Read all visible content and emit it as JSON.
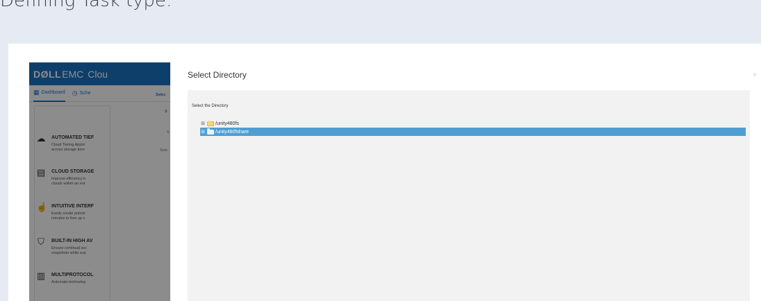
{
  "page": {
    "heading": "Defining Task type:"
  },
  "app": {
    "brand_bold": "DØLL",
    "brand_light": "EMC",
    "title": "Clou",
    "tabs": [
      {
        "label": "Dashboard",
        "icon": "dashboard-icon",
        "active": true
      },
      {
        "label": "Sche",
        "icon": "clock-icon",
        "active": false
      }
    ],
    "side_text": [
      "Selec",
      "S",
      "S",
      "Sele"
    ],
    "features": [
      {
        "icon": "cloud-sync-icon",
        "title": "AUTOMATED TIEF",
        "desc": [
          "Cloud Tiering Applic",
          "across storage tiers"
        ]
      },
      {
        "icon": "storage-icon",
        "title": "CLOUD STORAGE",
        "desc": [
          "Improve efficiency b",
          "clouds within an ent"
        ]
      },
      {
        "icon": "hand-pointer-icon",
        "title": "INTUITIVE INTERF",
        "desc": [
          "Easily create policie",
          "minutes to free up v"
        ]
      },
      {
        "icon": "shield-icon",
        "title": "BUILT-IN HIGH AV",
        "desc": [
          "Ensure continual acc",
          "snapshots while sup"
        ]
      },
      {
        "icon": "multiprotocol-icon",
        "title": "MULTIPROTOCOL",
        "desc": [
          "Automate technolog"
        ]
      }
    ]
  },
  "modal": {
    "title": "Select Directory",
    "close": "×",
    "label": "Select the Directory",
    "tree": [
      {
        "expander": "⊞",
        "name": "/unity480fs",
        "selected": false
      },
      {
        "expander": "⊞",
        "name": "/unity480fshare",
        "selected": true
      }
    ]
  },
  "colors": {
    "brand": "#1a73c4",
    "selection": "#4e9ed1",
    "backdrop": "#e6ebf3"
  }
}
